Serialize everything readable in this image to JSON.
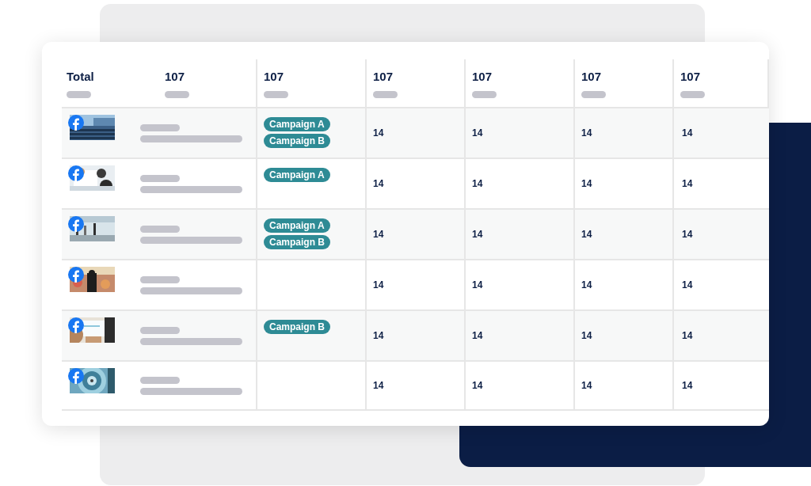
{
  "header": {
    "total_label": "Total",
    "columns": [
      "107",
      "107",
      "107",
      "107",
      "107",
      "107"
    ]
  },
  "rows": [
    {
      "image": {
        "kind": "picture"
      },
      "campaigns": [
        "Campaign A",
        "Campaign B"
      ],
      "values": [
        "14",
        "14",
        "14",
        "14"
      ]
    },
    {
      "image": {
        "kind": "picture"
      },
      "campaigns": [
        "Campaign A"
      ],
      "values": [
        "14",
        "14",
        "14",
        "14"
      ]
    },
    {
      "image": {
        "kind": "picture"
      },
      "campaigns": [
        "Campaign A",
        "Campaign B"
      ],
      "values": [
        "14",
        "14",
        "14",
        "14"
      ]
    },
    {
      "image": {
        "kind": "picture"
      },
      "campaigns": [],
      "values": [
        "14",
        "14",
        "14",
        "14"
      ]
    },
    {
      "image": {
        "kind": "picture"
      },
      "campaigns": [
        "Campaign B"
      ],
      "values": [
        "14",
        "14",
        "14",
        "14"
      ]
    },
    {
      "image": {
        "kind": "picture"
      },
      "campaigns": [],
      "values": [
        "14",
        "14",
        "14",
        "14"
      ]
    }
  ]
}
